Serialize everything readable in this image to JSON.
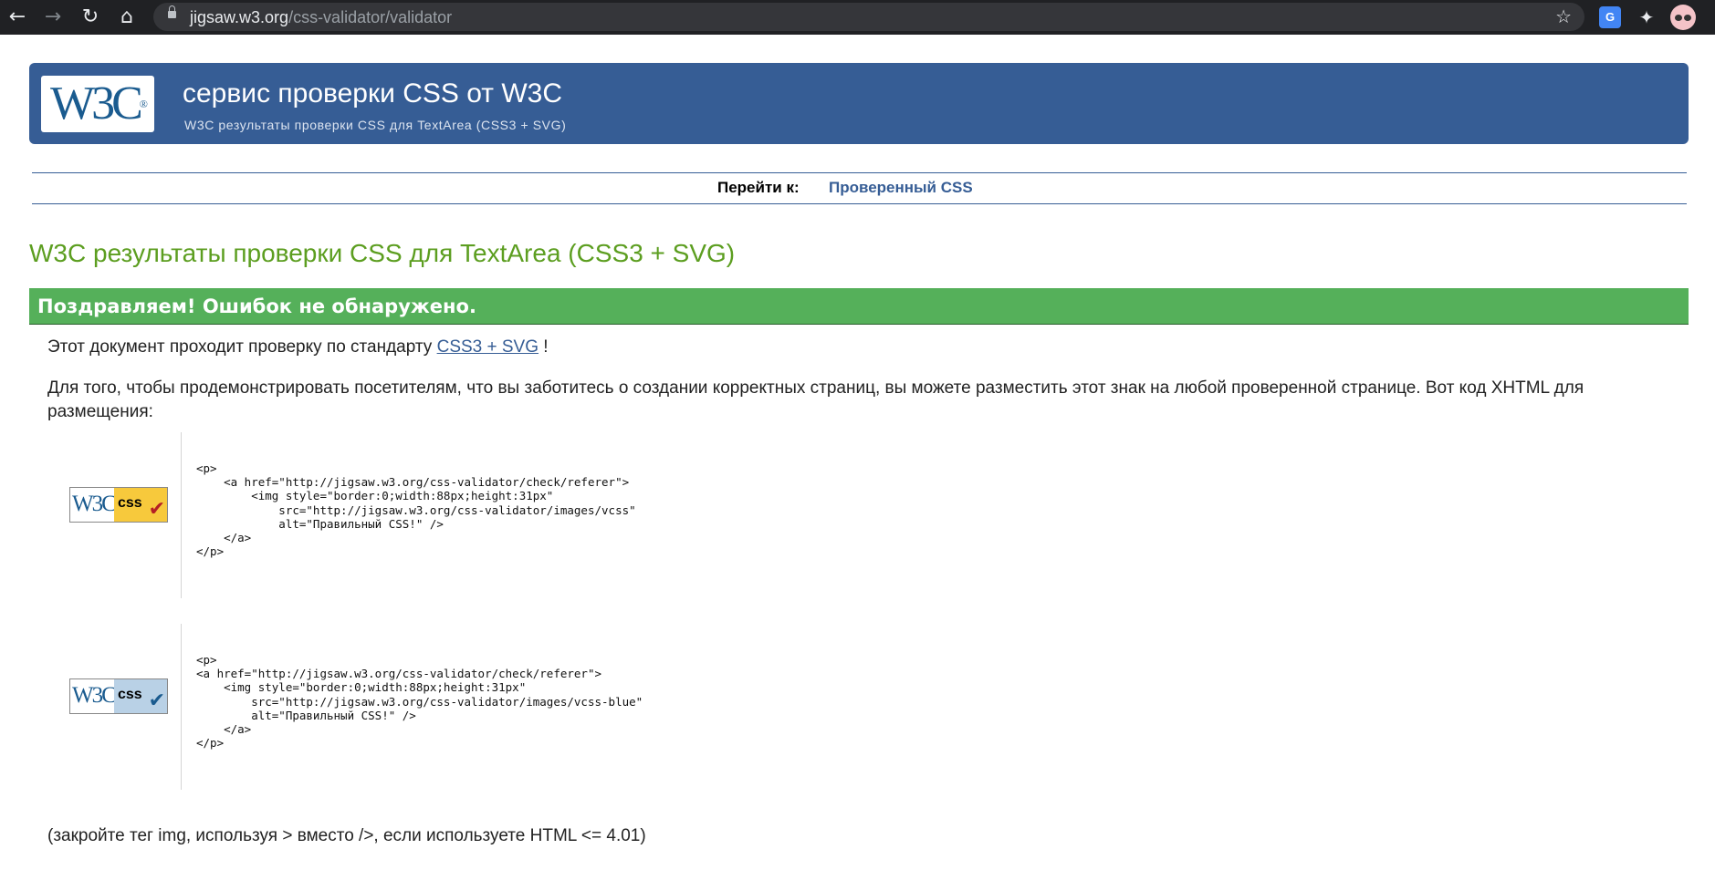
{
  "browser": {
    "url_host": "jigsaw.w3.org",
    "url_path": "/css-validator/validator",
    "back_icon": "←",
    "forward_icon": "→",
    "reload_icon": "↻",
    "home_icon": "⌂",
    "star_icon": "☆",
    "translate_icon": "G",
    "puzzle_icon": "✦"
  },
  "banner": {
    "logo_text": "W3C",
    "logo_mark": "®",
    "title": "сервис проверки CSS от W3C",
    "subtitle": "W3C результаты проверки CSS для TextArea (CSS3 + SVG)",
    "bg_color": "#365d95"
  },
  "jump": {
    "label": "Перейти к:",
    "link": "Проверенный CSS"
  },
  "heading": "W3C результаты проверки CSS для TextArea (CSS3 + SVG)",
  "congrats": "Поздравляем! Ошибок не обнаружено.",
  "pass": {
    "before": "Этот документ проходит проверку по стандарту ",
    "link": "CSS3 + SVG",
    "after": " !"
  },
  "badge_intro": "Для того, чтобы продемонстрировать посетителям, что вы заботитесь о создании корректных страниц, вы можете разместить этот знак на любой проверенной странице. Вот код XHTML для размещения:",
  "badges": [
    {
      "w3c": "W3C",
      "css": "css",
      "check": "✔",
      "code": "<p>\n    <a href=\"http://jigsaw.w3.org/css-validator/check/referer\">\n        <img style=\"border:0;width:88px;height:31px\"\n            src=\"http://jigsaw.w3.org/css-validator/images/vcss\"\n            alt=\"Правильный CSS!\" />\n    </a>\n</p>"
    },
    {
      "w3c": "W3C",
      "css": "css",
      "check": "✔",
      "code": "<p>\n<a href=\"http://jigsaw.w3.org/css-validator/check/referer\">\n    <img style=\"border:0;width:88px;height:31px\"\n        src=\"http://jigsaw.w3.org/css-validator/images/vcss-blue\"\n        alt=\"Правильный CSS!\" />\n    </a>\n</p>"
    }
  ],
  "footer_note": "(закройте тег img, используя > вместо />, если используете HTML <= 4.01)"
}
